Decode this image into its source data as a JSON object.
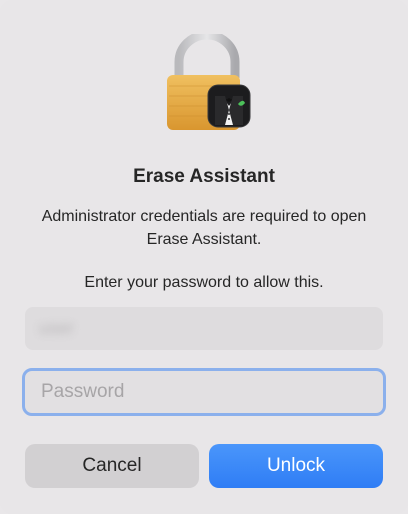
{
  "dialog": {
    "title": "Erase Assistant",
    "message": "Administrator credentials are required to open Erase Assistant.",
    "prompt": "Enter your password to allow this.",
    "username_value": "user",
    "password_placeholder": "Password",
    "cancel_label": "Cancel",
    "unlock_label": "Unlock"
  },
  "icons": {
    "lock": "padlock-icon",
    "app_badge": "erase-assistant-tuxedo-icon"
  },
  "colors": {
    "accent": "#3a86f8",
    "focus_ring": "#8bb0ec",
    "lock_gold": "#e5a847"
  }
}
